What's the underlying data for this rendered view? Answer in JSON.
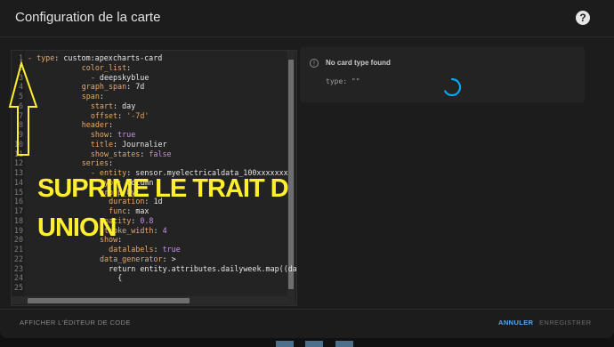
{
  "dialog": {
    "title": "Configuration de la carte",
    "help_icon": "?"
  },
  "editor": {
    "lines": [
      {
        "no": "1",
        "indent": 0,
        "dash": "- ",
        "key": "type",
        "value": "custom:apexcharts-card",
        "vclass": "v"
      },
      {
        "no": "2",
        "indent": 12,
        "key": "color_list",
        "value": "",
        "vclass": "v"
      },
      {
        "no": "3",
        "indent": 14,
        "dash": "- ",
        "key": "",
        "value": "deepskyblue",
        "vclass": "v"
      },
      {
        "no": "4",
        "indent": 12,
        "key": "graph_span",
        "value": "7d",
        "vclass": "v"
      },
      {
        "no": "5",
        "indent": 12,
        "key": "span",
        "value": "",
        "vclass": "v"
      },
      {
        "no": "6",
        "indent": 14,
        "key": "start",
        "value": "day",
        "vclass": "v"
      },
      {
        "no": "7",
        "indent": 14,
        "key": "offset",
        "value": "'-7d'",
        "vclass": "s"
      },
      {
        "no": "8",
        "indent": 12,
        "key": "header",
        "value": "",
        "vclass": "v"
      },
      {
        "no": "9",
        "indent": 14,
        "key": "show",
        "value": "true",
        "vclass": "n"
      },
      {
        "no": "10",
        "indent": 14,
        "key": "title",
        "value": "Journalier",
        "vclass": "v"
      },
      {
        "no": "11",
        "indent": 14,
        "key": "show_states",
        "value": "false",
        "vclass": "n"
      },
      {
        "no": "12",
        "indent": 12,
        "key": "series",
        "value": "",
        "vclass": "v"
      },
      {
        "no": "13",
        "indent": 14,
        "dash": "- ",
        "key": "entity",
        "value": "sensor.myelectricaldata_100xxxxxxx",
        "vclass": "v"
      },
      {
        "no": "14",
        "indent": 16,
        "key": "type",
        "value": "column",
        "vclass": "v"
      },
      {
        "no": "15",
        "indent": 16,
        "key": "group_by",
        "value": "",
        "vclass": "v"
      },
      {
        "no": "16",
        "indent": 18,
        "key": "duration",
        "value": "1d",
        "vclass": "v"
      },
      {
        "no": "17",
        "indent": 18,
        "key": "func",
        "value": "max",
        "vclass": "v"
      },
      {
        "no": "18",
        "indent": 16,
        "key": "opacity",
        "value": "0.8",
        "vclass": "n"
      },
      {
        "no": "19",
        "indent": 16,
        "key": "stroke_width",
        "value": "4",
        "vclass": "n"
      },
      {
        "no": "20",
        "indent": 16,
        "key": "show",
        "value": "",
        "vclass": "v"
      },
      {
        "no": "21",
        "indent": 18,
        "key": "datalabels",
        "value": "true",
        "vclass": "n"
      },
      {
        "no": "22",
        "indent": 16,
        "key": "data_generator",
        "value": ">",
        "vclass": "v"
      },
      {
        "no": "23",
        "indent": 18,
        "key": "",
        "value": "return entity.attributes.dailyweek.map((dailyw",
        "vclass": "v"
      },
      {
        "no": "24",
        "indent": 20,
        "key": "",
        "value": "{",
        "vclass": "v"
      },
      {
        "no": "25",
        "indent": 20,
        "key": "",
        "value": "",
        "vclass": "v"
      }
    ]
  },
  "annotation": {
    "line1": "SUPRIME LE TRAIT D",
    "line2": "UNION",
    "arrow_color": "#ffef2e"
  },
  "preview": {
    "icon": "warning-circle-icon",
    "title": "No card type found",
    "code": "type: \"\""
  },
  "footer": {
    "show_editor": "AFFICHER L'ÉDITEUR DE CODE",
    "cancel": "ANNULER",
    "save": "ENREGISTRER"
  },
  "colors": {
    "accent": "#03a9f4",
    "annotation": "#ffef2e"
  }
}
